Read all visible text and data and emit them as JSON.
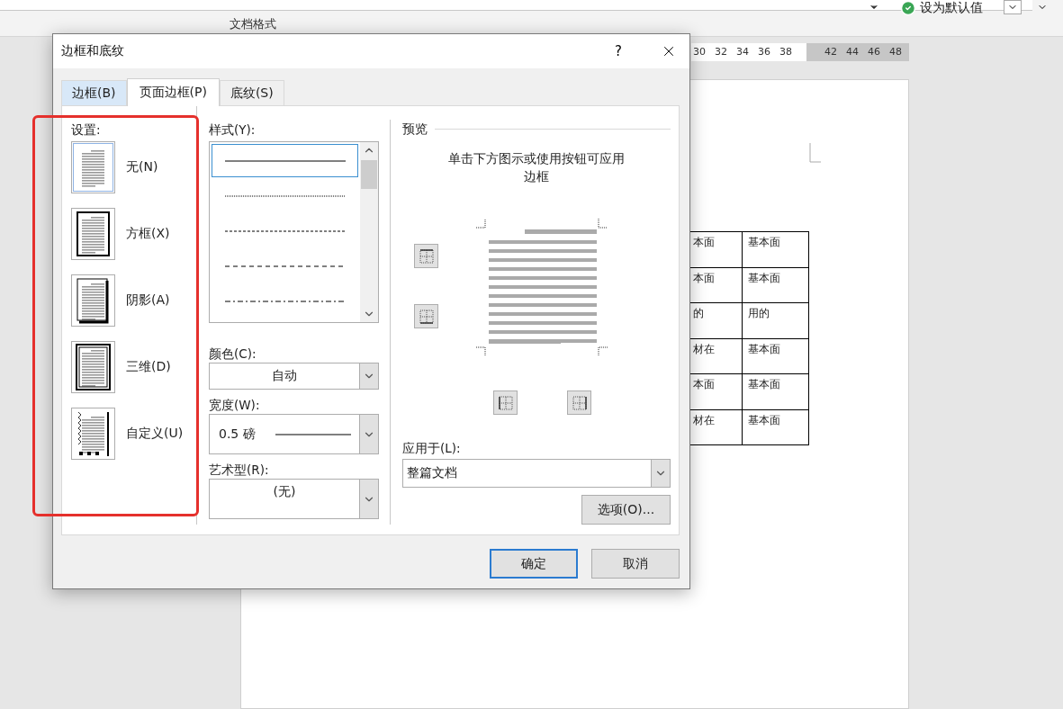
{
  "ribbon": {
    "group_label": "文档格式",
    "set_default_button": "设为默认值"
  },
  "ruler": {
    "ticks": [
      "30",
      "32",
      "34",
      "36",
      "38",
      "42",
      "44",
      "46",
      "48"
    ]
  },
  "document": {
    "table": {
      "rows": [
        [
          "本面",
          "基本面"
        ],
        [
          "本面",
          "基本面"
        ],
        [
          "的",
          "用的"
        ],
        [
          "材在",
          "基本面"
        ],
        [
          "本面",
          "基本面"
        ],
        [
          "材在",
          "基本面"
        ]
      ]
    }
  },
  "dialog": {
    "title": "边框和底纹",
    "help": "?",
    "tabs": [
      {
        "label": "边框(B)",
        "selected": false,
        "hover": true
      },
      {
        "label": "页面边框(P)",
        "selected": true,
        "hover": false
      },
      {
        "label": "底纹(S)",
        "selected": false,
        "hover": false
      }
    ],
    "setting": {
      "label": "设置:",
      "items": [
        {
          "kind": "none",
          "label": "无(N)",
          "selected": true
        },
        {
          "kind": "box",
          "label": "方框(X)",
          "selected": false
        },
        {
          "kind": "shadow",
          "label": "阴影(A)",
          "selected": false
        },
        {
          "kind": "threed",
          "label": "三维(D)",
          "selected": false
        },
        {
          "kind": "custom",
          "label": "自定义(U)",
          "selected": false
        }
      ]
    },
    "style": {
      "label": "样式(Y):",
      "items": [
        {
          "kind": "solid",
          "selected": true
        },
        {
          "kind": "dotted",
          "selected": false
        },
        {
          "kind": "dashed",
          "selected": false
        },
        {
          "kind": "long-dashed",
          "selected": false
        },
        {
          "kind": "dash-dot",
          "selected": false
        }
      ]
    },
    "color": {
      "label": "颜色(C):",
      "value": "自动"
    },
    "width": {
      "label": "宽度(W):",
      "value": "0.5 磅"
    },
    "art": {
      "label": "艺术型(R):",
      "value": "(无)"
    },
    "preview": {
      "label": "预览",
      "hint": "单击下方图示或使用按钮可应用边框"
    },
    "apply_to": {
      "label": "应用于(L):",
      "value": "整篇文档"
    },
    "options_button": "选项(O)...",
    "buttons": [
      {
        "label": "确定",
        "default": true
      },
      {
        "label": "取消",
        "default": false
      }
    ]
  }
}
